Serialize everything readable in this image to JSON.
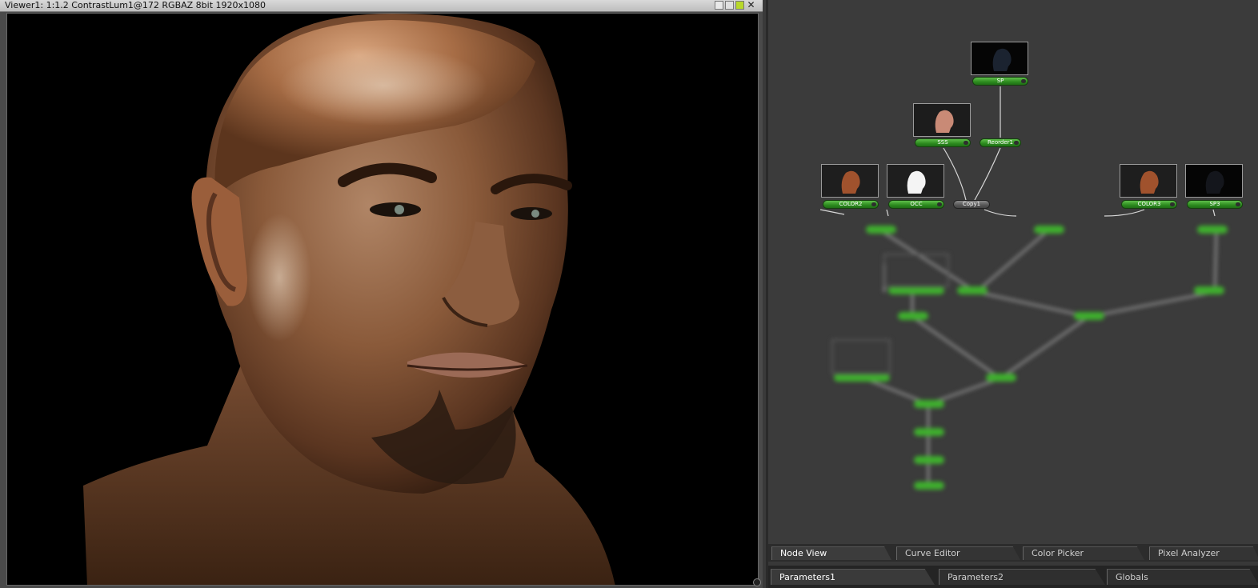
{
  "viewer": {
    "title": "Viewer1: 1:1.2 ContrastLum1@172 RGBAZ 8bit 1920x1080"
  },
  "nodes": {
    "sp": "SP",
    "sss": "SSS",
    "reorder": "Reorder1",
    "color2": "COLOR2",
    "occ": "OCC",
    "copy": "Copy1",
    "color3": "COLOR3",
    "sp3": "SP3"
  },
  "tabs_top": [
    "Node View",
    "Curve Editor",
    "Color Picker",
    "Pixel Analyzer"
  ],
  "tabs_bottom": [
    "Parameters1",
    "Parameters2",
    "Globals"
  ],
  "colors": {
    "node_green": "#2c8a1e",
    "viewer_bg": "#000000",
    "panel_bg": "#3b3b3b"
  }
}
